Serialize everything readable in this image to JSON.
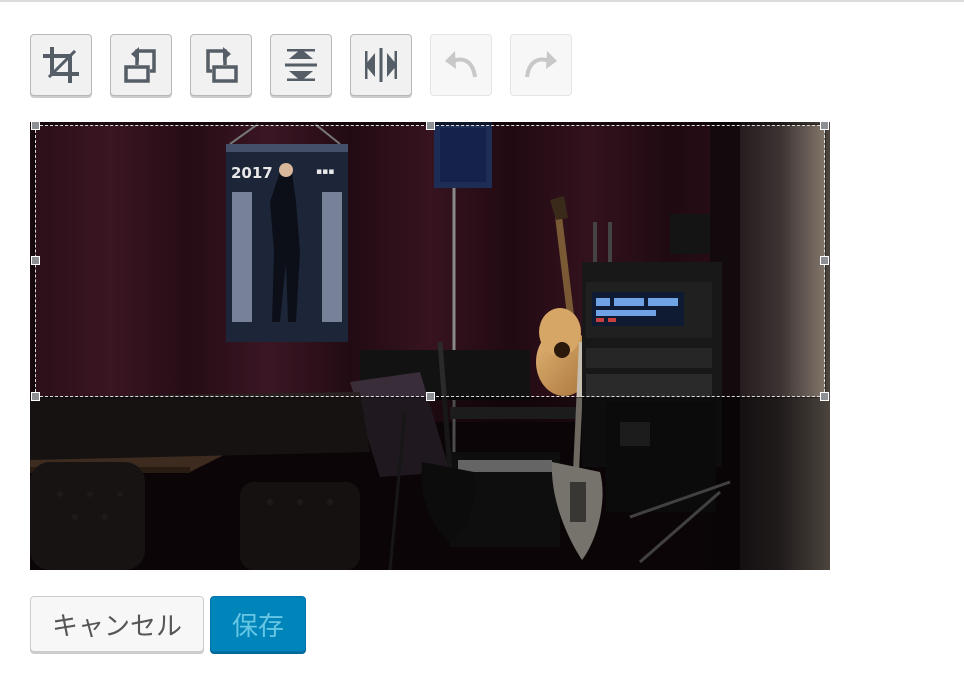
{
  "toolbar": {
    "tools": [
      {
        "name": "crop",
        "icon": "crop-icon",
        "enabled": true
      },
      {
        "name": "rotate-left",
        "icon": "rotate-left-icon",
        "enabled": true
      },
      {
        "name": "rotate-right",
        "icon": "rotate-right-icon",
        "enabled": true
      },
      {
        "name": "flip-vertical",
        "icon": "flip-vertical-icon",
        "enabled": true
      },
      {
        "name": "flip-horizontal",
        "icon": "flip-horizontal-icon",
        "enabled": true
      },
      {
        "name": "undo",
        "icon": "undo-icon",
        "enabled": false
      },
      {
        "name": "redo",
        "icon": "redo-icon",
        "enabled": false
      }
    ]
  },
  "image": {
    "poster_year": "2017"
  },
  "actions": {
    "cancel_label": "キャンセル",
    "save_label": "保存"
  },
  "colors": {
    "primary": "#0085ba",
    "icon": "#555d66",
    "icon_disabled": "#c8c8c8"
  }
}
